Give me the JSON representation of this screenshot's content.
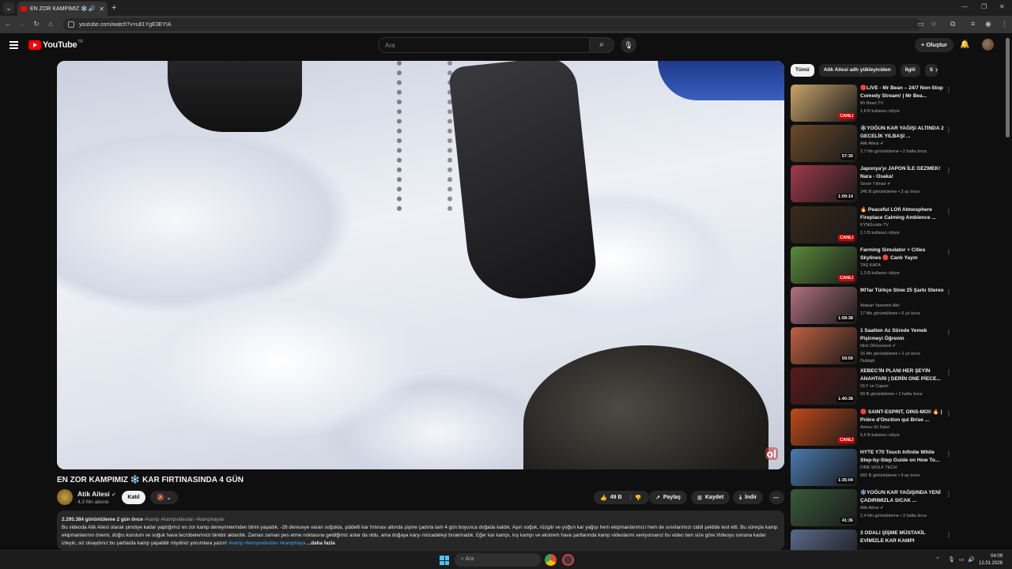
{
  "browser": {
    "tab_title": "EN ZOR KAMPIMIZ ❄️ KAR",
    "url": "youtube.com/watch?v=u81YgE3EYIA"
  },
  "header": {
    "logo_text": "YouTube",
    "logo_country": "TR",
    "search_placeholder": "Ara",
    "create_label": "Oluştur"
  },
  "video": {
    "title": "EN ZOR KAMPIMIZ ❄️ KAR FIRTINASINDA 4 GÜN",
    "watermark": "ol",
    "channel": {
      "name": "Atik Ailesi",
      "subscribers": "4,3 Mn abone",
      "join_label": "Katıl"
    },
    "actions": {
      "likes": "49 B",
      "share": "Paylaş",
      "save": "Kaydet",
      "download": "İndir"
    },
    "description": {
      "stats": "2.295.384 görüntüleme  2 gün önce",
      "tags_top": "#kamp #kampvideoları #kamphayatı",
      "text": "Bu videoda Atik Ailesi olarak şimdiye kadar yaptığımız en zor kamp deneyimlerinden birini yaşadık. -28 dereceye varan soğukta, şiddetli kar fırtınası altında şişme çadırla tam 4 gün boyunca doğada kaldık. Aşırı soğuk, rüzgâr ve yoğun kar yağışı hem ekipmanlarımızı hem de sınırlarımızı ciddi şekilde test etti. Bu süreçte kamp ekipmanlarının önemi, doğru kurulum ve soğuk hava tecrübelerimizi birebir aktardık. Zaman zaman pes etme noktasına geldiğimiz anlar da oldu, ama doğaya karşı mücadeleyi bırakmadık. Eğer kar kampı, kış kampı ve ekstrem hava şartlarında kamp videolarını seviyorsanız bu video tam size göre.Videoyu sonuna kadar izleyin, siz olsaydınız bu şartlarda kamp yapabilir miydiniz yorumlara yazın!",
      "tags_inline": "#kamp #kampvideoları #kamphaya",
      "more_label": "...daha fazla"
    }
  },
  "sidebar": {
    "chips": [
      "Tümü",
      "Atik Ailesi adlı yükleyiciden",
      "İlgili",
      "S"
    ],
    "recommendations": [
      {
        "title": "🔴LIVE - Mr Bean – 24/7 Non-Stop Comedy Stream! | Mr Bea...",
        "channel": "Mr Bean TV",
        "meta": "1,8 B kullanıcı izliyor",
        "badge": "CANLI",
        "live": true,
        "color": "#c9a46a"
      },
      {
        "title": "❄️YOĞUN KAR YAĞIŞI ALTINDA 2 GECELİK YILBAŞI ...",
        "channel": "Atik Ailesi ✔",
        "meta": "2,7 Mn görüntüleme • 2 hafta önce",
        "badge": "57:30",
        "live": false,
        "color": "#6a4a2a"
      },
      {
        "title": "Japonya'yı JAPON İLE GEZMEK! Nara - Osaka!",
        "channel": "Sezer Yılmaz ✔",
        "meta": "245 B görüntüleme • 3 ay önce",
        "badge": "1:09:14",
        "live": false,
        "color": "#a03a4a"
      },
      {
        "title": "🔥 Peaceful LOfi Atmosphere Fireplace Calming Ambience ...",
        "channel": "KYNGcode TV",
        "meta": "2,1 B kullanıcı izliyor",
        "badge": "CANLI",
        "live": true,
        "color": "#3a2a1a"
      },
      {
        "title": "Farming Simulator + Cities Skylines 🔴 Canlı Yayın",
        "channel": "TAŞ KAFA",
        "meta": "1,3 B kullanıcı izliyor",
        "badge": "CANLI",
        "live": true,
        "color": "#5a8a3a"
      },
      {
        "title": "90'lar Türkçe Slow 25 Şarkı Stereo",
        "channel": "Atakan Yasemin Akil",
        "meta": "17 Mn görüntüleme • 6 yıl önce",
        "badge": "1:58:38",
        "live": false,
        "color": "#b07080"
      },
      {
        "title": "1 Saatten Az Sürede Yemek Pişirmeyi Öğrenin",
        "channel": "Nick DiGiovanni ✔",
        "meta": "16 Mn görüntüleme • 2 yıl önce",
        "extra": "Dublajlı",
        "badge": "59:59",
        "live": false,
        "color": "#c06040"
      },
      {
        "title": "XEBEC'İN PLANI HER ŞEYİN ANAHTARI | DERİN ONE PİECE...",
        "channel": "OLY ve Capori",
        "meta": "69 B görüntüleme • 2 hafta önce",
        "badge": "1:40:38",
        "live": false,
        "color": "#5a1a1a"
      },
      {
        "title": "🔴 SAINT-ESPRIT, OINS-MOI! 🔥 | Prière d'Onction qui Brise ...",
        "channel": "Amour Et Salut",
        "meta": "9,5 B kullanıcı izliyor",
        "badge": "CANLI",
        "live": true,
        "color": "#c04a1a"
      },
      {
        "title": "HYTE Y70 Touch Infinite White Step-by-Step Guide on How To...",
        "channel": "FIRE WOLF TECH",
        "meta": "582 B görüntüleme • 9 ay önce",
        "badge": "1:35:04",
        "live": false,
        "color": "#4a7ab0"
      },
      {
        "title": "❄️YOĞUN KAR YAĞIŞINDA YENİ ÇADIRIMIZLA SICAK ...",
        "channel": "Atik Ailesi ✔",
        "meta": "2,4 Mn görüntüleme • 3 hafta önce",
        "badge": "41:36",
        "live": false,
        "color": "#3a5a3a"
      },
      {
        "title": "3 ODALI ŞİŞME MÜSTAKİL EVİMİZLE KAR KAMPI",
        "channel": "",
        "meta": "",
        "badge": "",
        "live": false,
        "color": "#5a6a8a"
      }
    ]
  },
  "taskbar": {
    "search_placeholder": "Ara",
    "time": "04:09",
    "date": "12.01.2026"
  }
}
